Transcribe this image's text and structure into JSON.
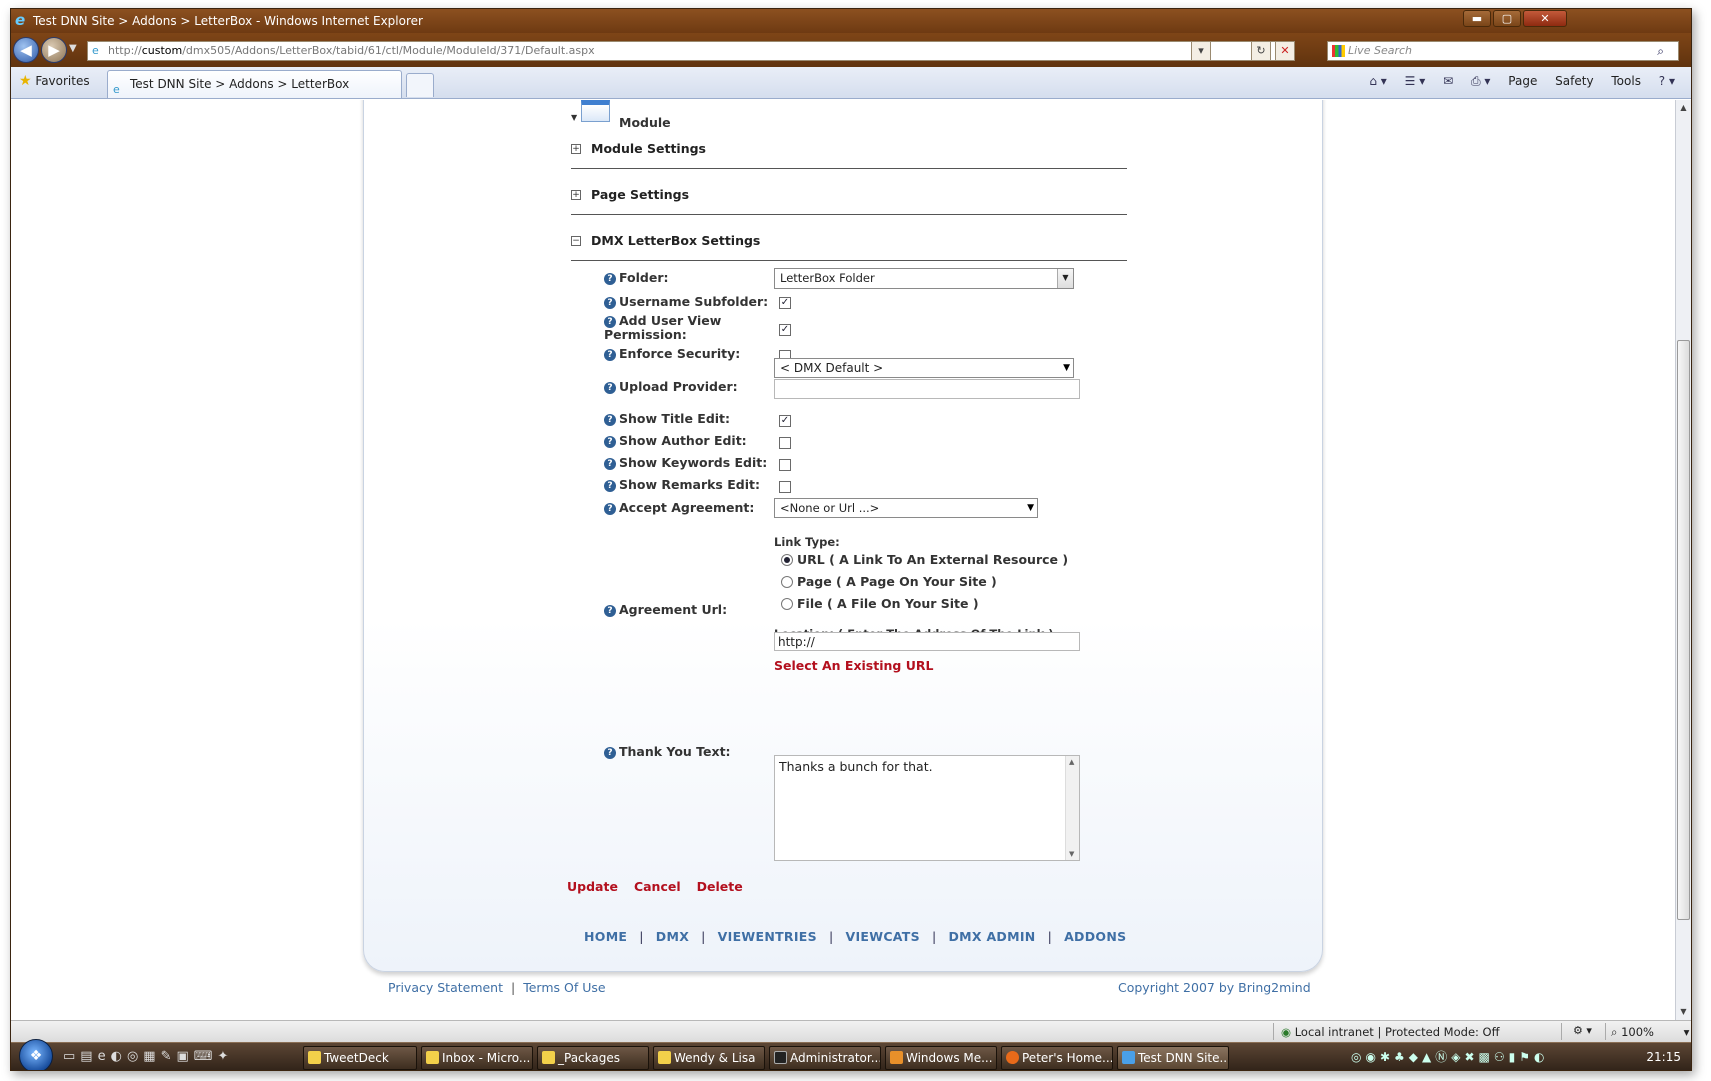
{
  "window": {
    "title": "Test DNN Site > Addons > LetterBox - Windows Internet Explorer",
    "controls": {
      "minimize": "▬",
      "maximize": "▢",
      "close": "✕"
    }
  },
  "address": {
    "url_prefix": "http://",
    "url_host": "custom",
    "url_path": "/dmx505/Addons/LetterBox/tabid/61/ctl/Module/ModuleId/371/Default.aspx",
    "search_placeholder": "Live Search"
  },
  "tabs": {
    "favorites_label": "Favorites",
    "active_tab_label": "Test DNN Site > Addons > LetterBox"
  },
  "commandbar": {
    "page": "Page",
    "safety": "Safety",
    "tools": "Tools"
  },
  "content": {
    "module_label": "Module",
    "sections": {
      "module_settings": "Module Settings",
      "page_settings": "Page Settings",
      "letterbox_settings": "DMX LetterBox Settings"
    },
    "fields": {
      "folder": {
        "label": "Folder:",
        "value": "LetterBox Folder"
      },
      "username_subfolder": {
        "label": "Username Subfolder:",
        "checked": true
      },
      "add_user_view_permission": {
        "label_line1": "Add User View",
        "label_line2": "Permission:",
        "checked": true
      },
      "enforce_security": {
        "label": "Enforce Security:",
        "checked": false
      },
      "upload_provider": {
        "label": "Upload Provider:",
        "value": "< DMX Default >"
      },
      "show_title_edit": {
        "label": "Show Title Edit:",
        "checked": true
      },
      "show_author_edit": {
        "label": "Show Author Edit:",
        "checked": false
      },
      "show_keywords_edit": {
        "label": "Show Keywords Edit:",
        "checked": false
      },
      "show_remarks_edit": {
        "label": "Show Remarks Edit:",
        "checked": false
      },
      "accept_agreement": {
        "label": "Accept Agreement:",
        "value": "<None or Url ...>"
      },
      "agreement_url": {
        "label": "Agreement Url:",
        "link_type_label": "Link Type:",
        "options": [
          {
            "label": "URL ( A Link To An External Resource )",
            "selected": true
          },
          {
            "label": "Page ( A Page On Your Site )",
            "selected": false
          },
          {
            "label": "File ( A File On Your Site )",
            "selected": false
          }
        ],
        "location_label": "Location: ( Enter The Address Of The Link )",
        "location_value": "http://",
        "select_existing": "Select An Existing URL"
      },
      "thank_you_text": {
        "label": "Thank You Text:",
        "value": "Thanks a bunch for that."
      }
    },
    "actions": {
      "update": "Update",
      "cancel": "Cancel",
      "delete": "Delete"
    },
    "menu": [
      "HOME",
      "DMX",
      "VIEWENTRIES",
      "VIEWCATS",
      "DMX ADMIN",
      "ADDONS"
    ],
    "footer": {
      "privacy": "Privacy Statement",
      "terms": "Terms Of Use",
      "copyright": "Copyright 2007 by Bring2mind"
    }
  },
  "status": {
    "zone": "Local intranet | Protected Mode: Off",
    "zoom": "100%"
  },
  "taskbar": {
    "buttons": [
      "TweetDeck",
      "Inbox - Micro...",
      "_Packages",
      "Wendy & Lisa",
      "Administrator...",
      "Windows Me...",
      "Peter's Home...",
      "Test DNN Site..."
    ],
    "clock": "21:15"
  }
}
